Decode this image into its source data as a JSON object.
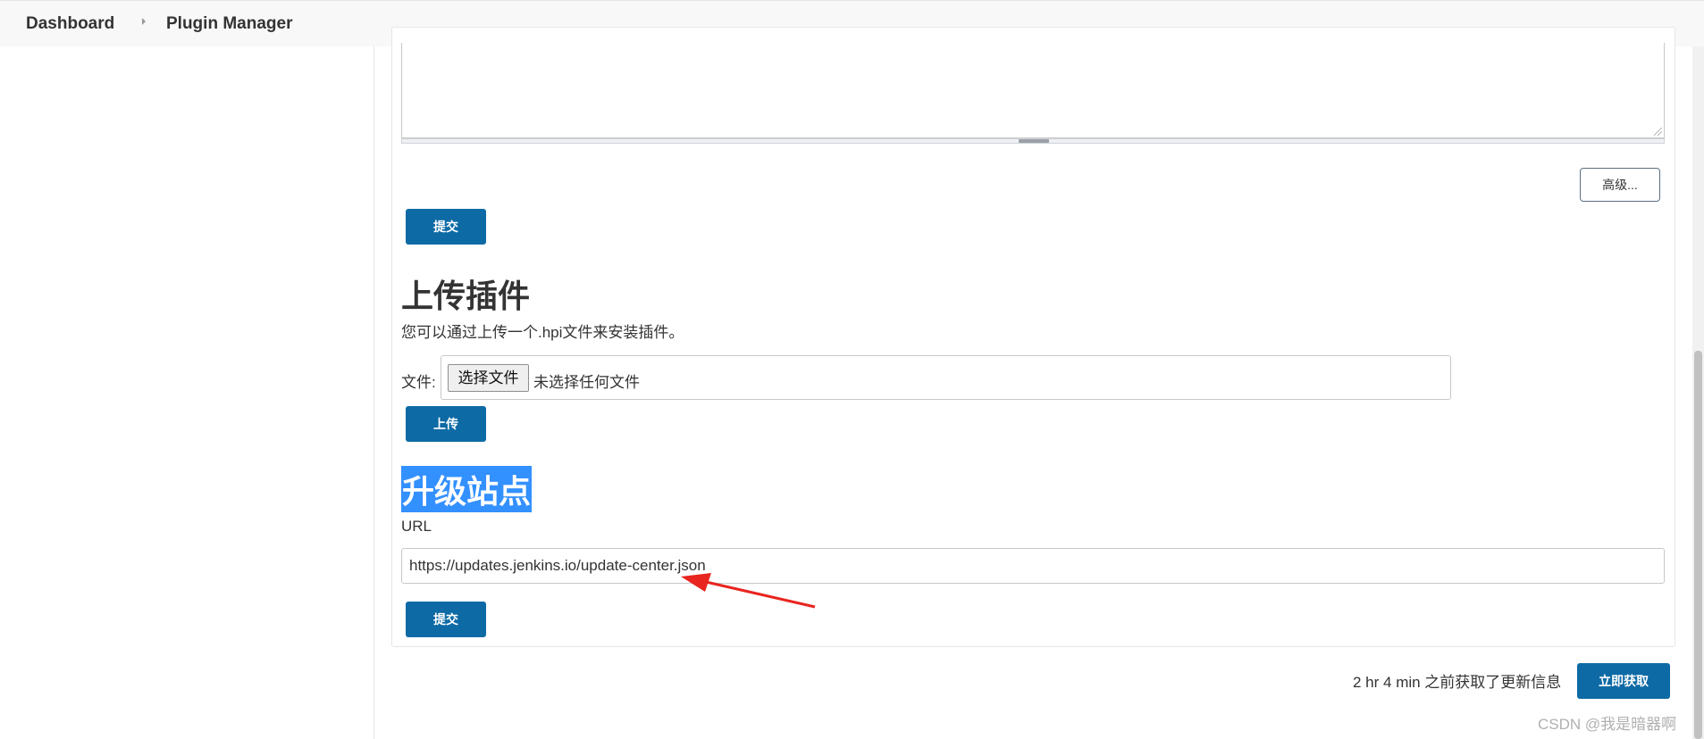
{
  "breadcrumb": {
    "items": [
      "Dashboard",
      "Plugin Manager"
    ]
  },
  "advanced_button": "高级...",
  "submit_top": "提交",
  "upload_section": {
    "title": "上传插件",
    "description": "您可以通过上传一个.hpi文件来安装插件。",
    "file_label": "文件:",
    "file_button": "选择文件",
    "file_status": "未选择任何文件",
    "upload_button": "上传"
  },
  "update_site_section": {
    "title": "升级站点",
    "url_label": "URL",
    "url_value": "https://updates.jenkins.io/update-center.json",
    "submit_button": "提交"
  },
  "footer": {
    "status": "2 hr 4 min 之前获取了更新信息",
    "check_now_button": "立即获取"
  },
  "watermark": "CSDN @我是暗器啊",
  "colors": {
    "primary_button": "#0d6aa5",
    "selection": "#3390ff",
    "annotation_arrow": "#e8251f"
  }
}
